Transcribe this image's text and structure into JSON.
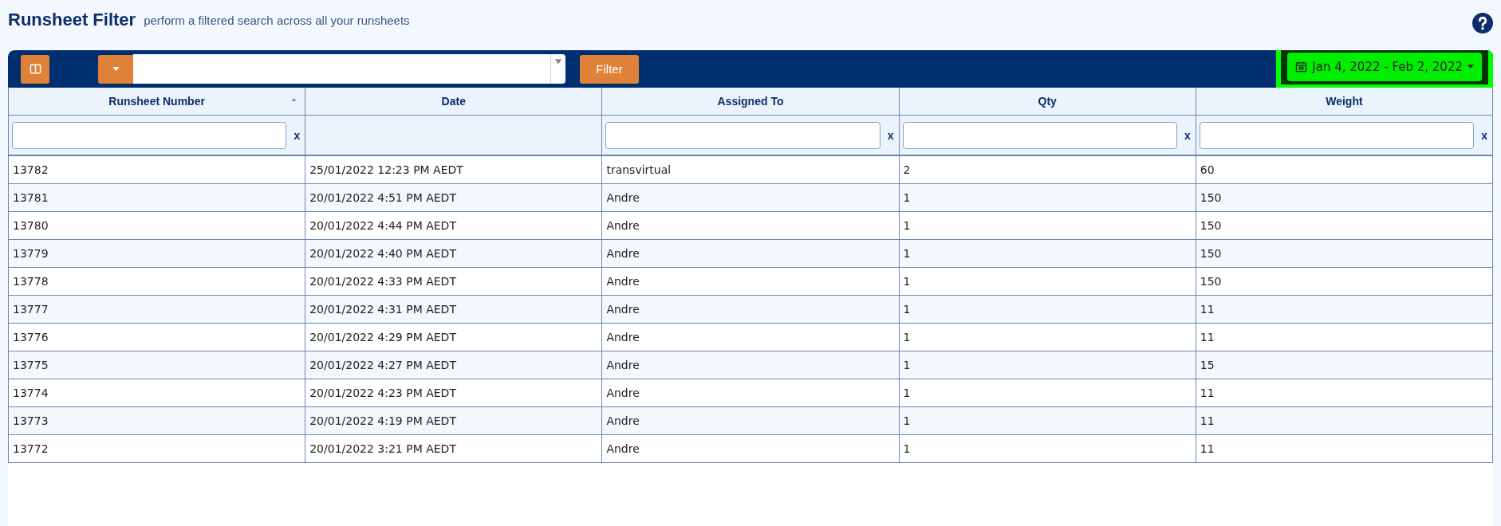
{
  "page": {
    "title": "Runsheet Filter",
    "subtitle": "perform a filtered search across all your runsheets"
  },
  "toolbar": {
    "filter_button": "Filter",
    "date_range": "Jan 4, 2022 - Feb 2, 2022"
  },
  "table": {
    "columns": [
      {
        "label": "Runsheet Number",
        "sorted": true,
        "clear": "x"
      },
      {
        "label": "Date",
        "sorted": false
      },
      {
        "label": "Assigned To",
        "sorted": false,
        "clear": "x"
      },
      {
        "label": "Qty",
        "sorted": false,
        "clear": "x"
      },
      {
        "label": "Weight",
        "sorted": false,
        "clear": "x"
      }
    ],
    "rows": [
      [
        "13782",
        "25/01/2022 12:23 PM AEDT",
        "transvirtual",
        "2",
        "60"
      ],
      [
        "13781",
        "20/01/2022 4:51 PM AEDT",
        "Andre",
        "1",
        "150"
      ],
      [
        "13780",
        "20/01/2022 4:44 PM AEDT",
        "Andre",
        "1",
        "150"
      ],
      [
        "13779",
        "20/01/2022 4:40 PM AEDT",
        "Andre",
        "1",
        "150"
      ],
      [
        "13778",
        "20/01/2022 4:33 PM AEDT",
        "Andre",
        "1",
        "150"
      ],
      [
        "13777",
        "20/01/2022 4:31 PM AEDT",
        "Andre",
        "1",
        "11"
      ],
      [
        "13776",
        "20/01/2022 4:29 PM AEDT",
        "Andre",
        "1",
        "11"
      ],
      [
        "13775",
        "20/01/2022 4:27 PM AEDT",
        "Andre",
        "1",
        "15"
      ],
      [
        "13774",
        "20/01/2022 4:23 PM AEDT",
        "Andre",
        "1",
        "11"
      ],
      [
        "13773",
        "20/01/2022 4:19 PM AEDT",
        "Andre",
        "1",
        "11"
      ],
      [
        "13772",
        "20/01/2022 3:21 PM AEDT",
        "Andre",
        "1",
        "11"
      ]
    ]
  }
}
